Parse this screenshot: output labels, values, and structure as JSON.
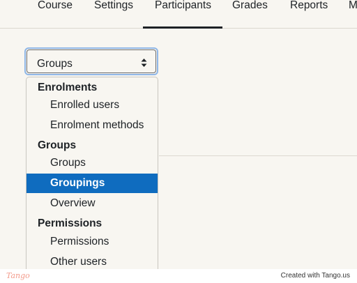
{
  "nav": {
    "tabs": [
      {
        "label": "Course"
      },
      {
        "label": "Settings"
      },
      {
        "label": "Participants",
        "active": true
      },
      {
        "label": "Grades"
      },
      {
        "label": "Reports"
      },
      {
        "label": "M"
      }
    ]
  },
  "select": {
    "value": "Groups",
    "icon": "sort-arrows-icon"
  },
  "dropdown": {
    "groups": [
      {
        "label": "Enrolments",
        "items": [
          "Enrolled users",
          "Enrolment methods"
        ]
      },
      {
        "label": "Groups",
        "items": [
          "Groups",
          "Groupings",
          "Overview"
        ]
      },
      {
        "label": "Permissions",
        "items": [
          "Permissions",
          "Other users"
        ]
      }
    ],
    "selected": "Groupings",
    "selected_color": "#0f6cbf"
  },
  "footer": {
    "brand": "Tango",
    "credit": "Created with Tango.us"
  }
}
